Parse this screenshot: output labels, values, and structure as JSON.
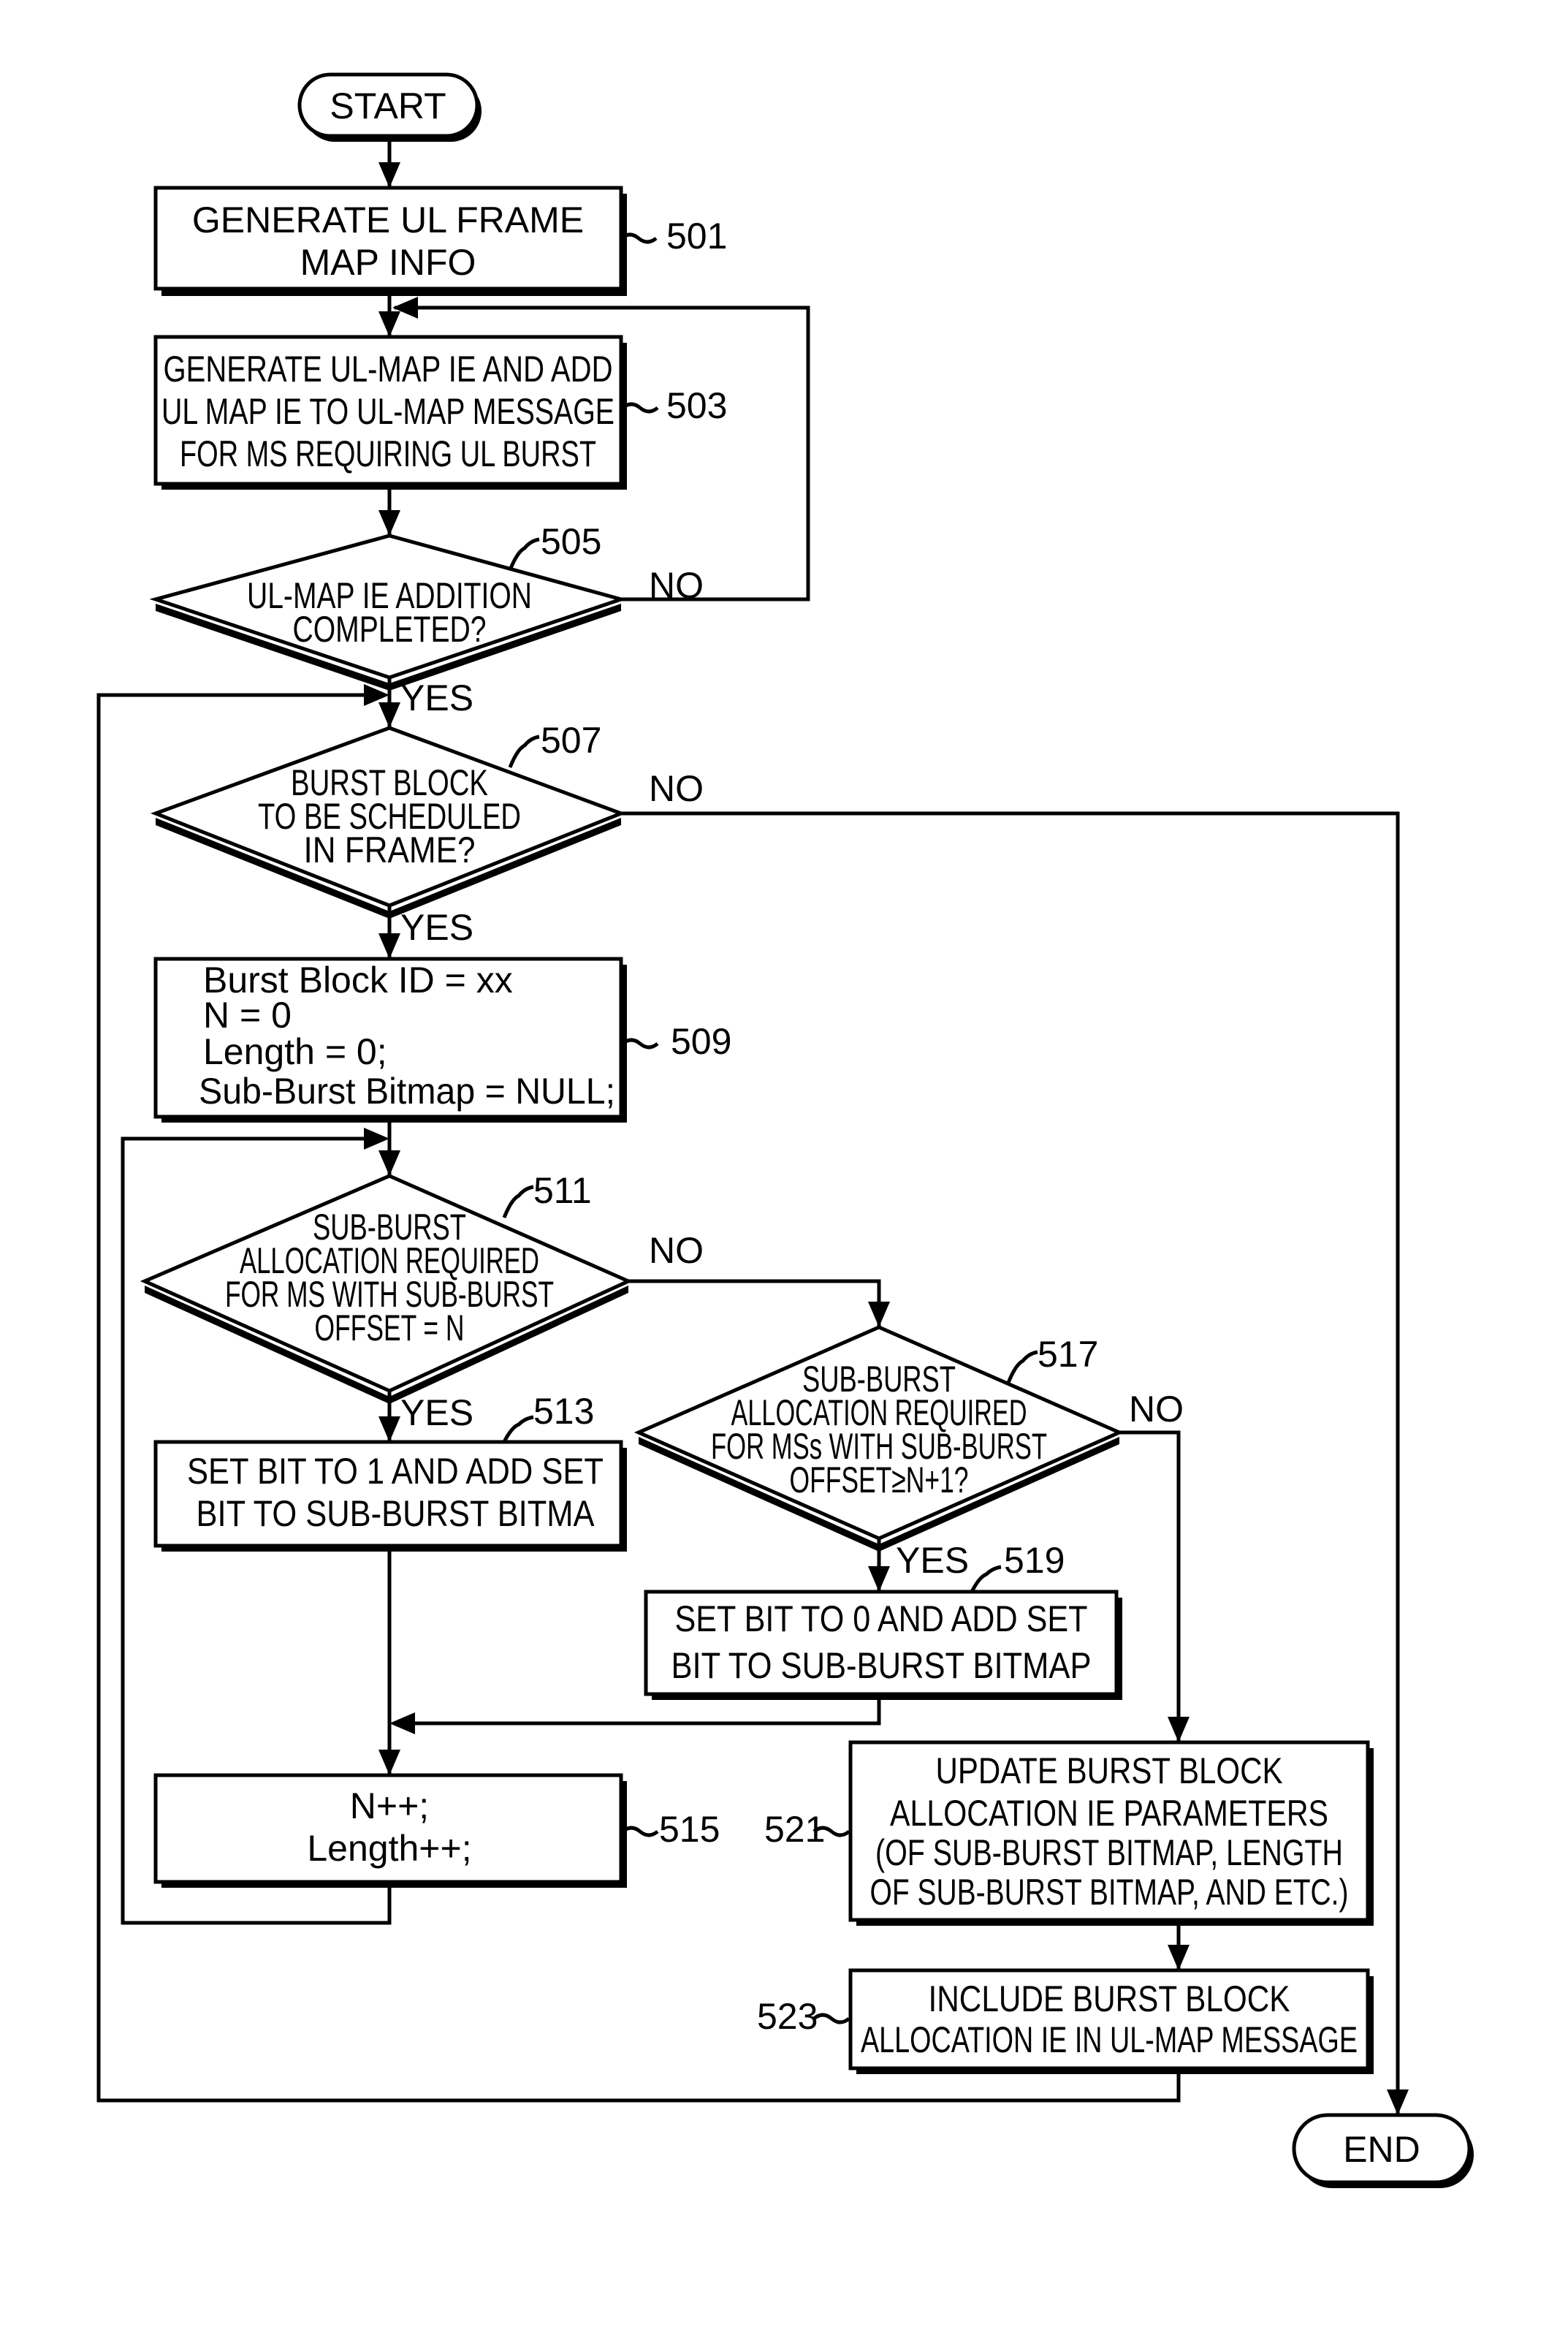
{
  "diagram": {
    "type": "flowchart",
    "start": {
      "label": "START"
    },
    "end": {
      "label": "END"
    },
    "nodes": {
      "n501": {
        "ref": "501",
        "kind": "process",
        "lines": [
          "GENERATE UL FRAME",
          "MAP INFO"
        ]
      },
      "n503": {
        "ref": "503",
        "kind": "process",
        "lines": [
          "GENERATE UL-MAP IE AND ADD",
          "UL MAP IE TO UL-MAP MESSAGE",
          "FOR MS REQUIRING UL BURST"
        ]
      },
      "n505": {
        "ref": "505",
        "kind": "decision",
        "lines": [
          "UL-MAP IE ADDITION",
          "COMPLETED?"
        ],
        "yes": "YES",
        "no": "NO"
      },
      "n507": {
        "ref": "507",
        "kind": "decision",
        "lines": [
          "BURST BLOCK",
          "TO BE SCHEDULED",
          "IN FRAME?"
        ],
        "yes": "YES",
        "no": "NO"
      },
      "n509": {
        "ref": "509",
        "kind": "process",
        "lines": [
          "Burst Block ID = xx",
          "N = 0",
          "Length = 0;",
          "Sub-Burst Bitmap = NULL;"
        ]
      },
      "n511": {
        "ref": "511",
        "kind": "decision",
        "lines": [
          "SUB-BURST",
          "ALLOCATION REQUIRED",
          "FOR MS WITH SUB-BURST",
          "OFFSET = N"
        ],
        "yes": "YES",
        "no": "NO"
      },
      "n513": {
        "ref": "513",
        "kind": "process",
        "lines": [
          "SET BIT TO 1 AND ADD SET",
          "BIT TO SUB-BURST BITMA"
        ]
      },
      "n515": {
        "ref": "515",
        "kind": "process",
        "lines": [
          "N++;",
          "Length++;"
        ]
      },
      "n517": {
        "ref": "517",
        "kind": "decision",
        "lines": [
          "SUB-BURST",
          "ALLOCATION REQUIRED",
          "FOR MSs WITH SUB-BURST",
          "OFFSET≥N+1?"
        ],
        "yes": "YES",
        "no": "NO"
      },
      "n519": {
        "ref": "519",
        "kind": "process",
        "lines": [
          "SET BIT TO 0 AND ADD SET",
          "BIT TO SUB-BURST BITMAP"
        ]
      },
      "n521": {
        "ref": "521",
        "kind": "process",
        "lines": [
          "UPDATE BURST BLOCK",
          "ALLOCATION IE PARAMETERS",
          "(OF SUB-BURST BITMAP, LENGTH",
          "OF SUB-BURST BITMAP, AND ETC.)"
        ]
      },
      "n523": {
        "ref": "523",
        "kind": "process",
        "lines": [
          "INCLUDE BURST BLOCK",
          "ALLOCATION IE IN UL-MAP MESSAGE"
        ]
      }
    },
    "edges": [
      {
        "from": "START",
        "to": "501"
      },
      {
        "from": "501",
        "to": "503"
      },
      {
        "from": "503",
        "to": "505"
      },
      {
        "from": "505",
        "to": "503",
        "label": "NO"
      },
      {
        "from": "505",
        "to": "507",
        "label": "YES"
      },
      {
        "from": "507",
        "to": "END",
        "label": "NO"
      },
      {
        "from": "507",
        "to": "509",
        "label": "YES"
      },
      {
        "from": "509",
        "to": "511"
      },
      {
        "from": "511",
        "to": "513",
        "label": "YES"
      },
      {
        "from": "511",
        "to": "517",
        "label": "NO"
      },
      {
        "from": "513",
        "to": "515"
      },
      {
        "from": "517",
        "to": "519",
        "label": "YES"
      },
      {
        "from": "517",
        "to": "521",
        "label": "NO"
      },
      {
        "from": "519",
        "to": "515"
      },
      {
        "from": "515",
        "to": "511"
      },
      {
        "from": "521",
        "to": "523"
      },
      {
        "from": "523",
        "to": "507"
      }
    ]
  }
}
